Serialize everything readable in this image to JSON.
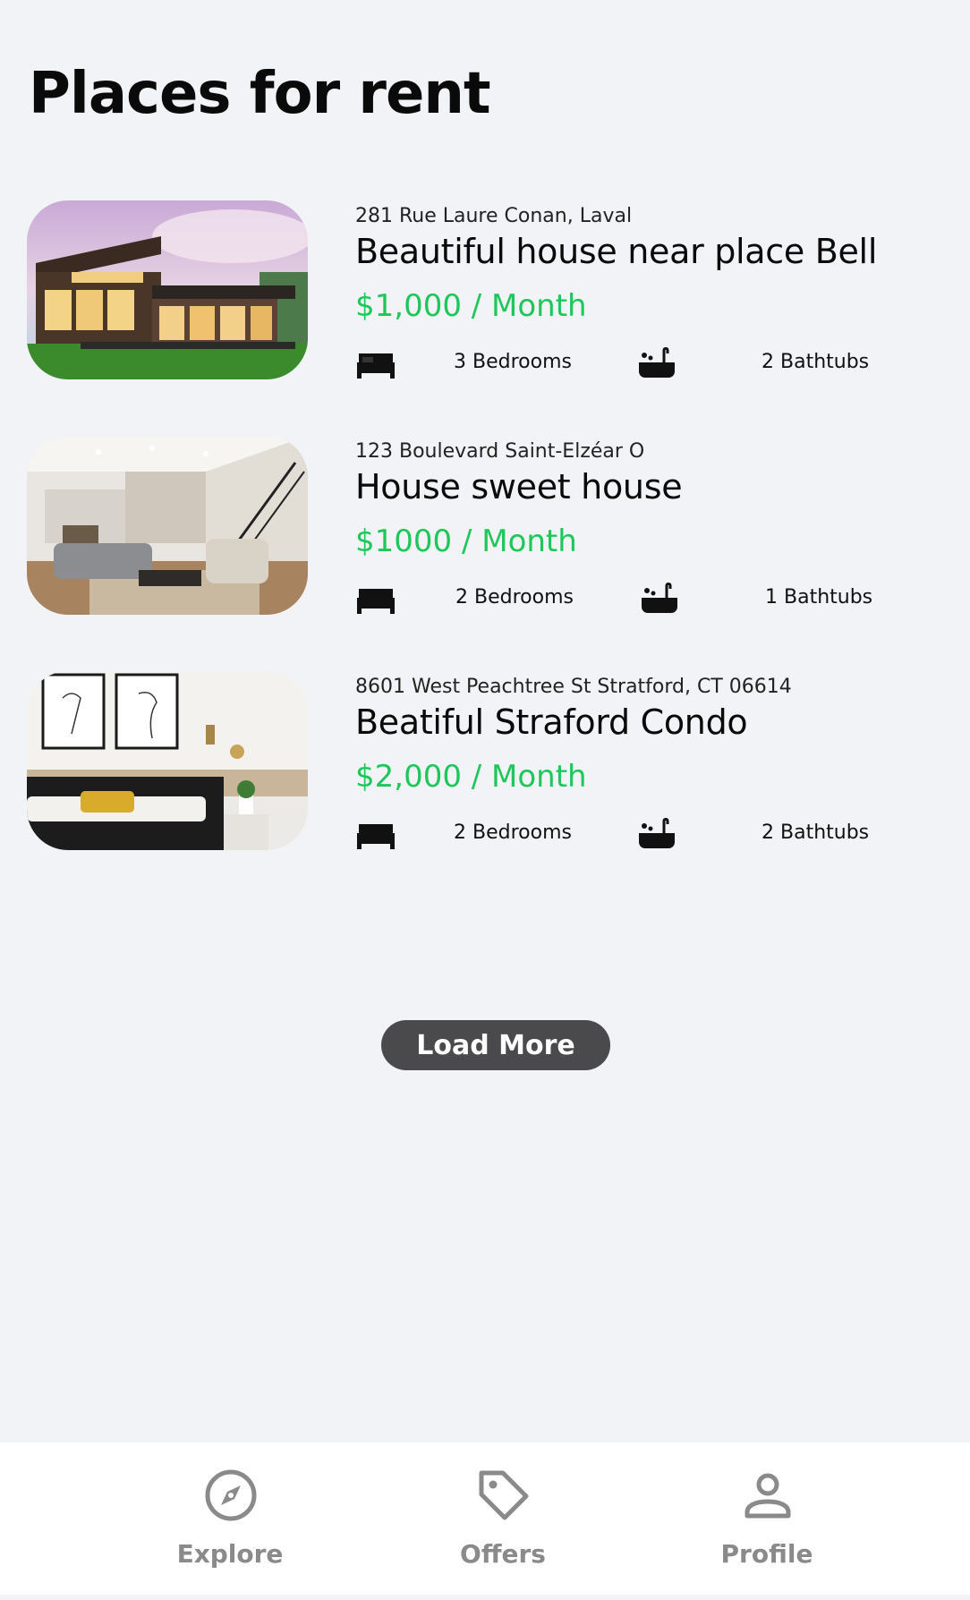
{
  "page": {
    "title": "Places for rent"
  },
  "listings": [
    {
      "address": "281 Rue Laure Conan, Laval",
      "name": "Beautiful house near place Bell",
      "price": "$1,000 / Month",
      "bedrooms": "3 Bedrooms",
      "bathtubs": "2 Bathtubs",
      "image": "modern-house-exterior"
    },
    {
      "address": "123 Boulevard Saint-Elzéar O",
      "name": "House sweet house",
      "price": "$1000 / Month",
      "bedrooms": "2 Bedrooms",
      "bathtubs": "1 Bathtubs",
      "image": "living-room-interior"
    },
    {
      "address": "8601 West Peachtree St Stratford, CT 06614",
      "name": "Beatiful Straford Condo",
      "price": "$2,000 / Month",
      "bedrooms": "2 Bedrooms",
      "bathtubs": "2 Bathtubs",
      "image": "bedroom-interior"
    }
  ],
  "load_more_label": "Load More",
  "nav": {
    "items": [
      {
        "label": "Explore",
        "icon": "compass-icon"
      },
      {
        "label": "Offers",
        "icon": "tag-icon"
      },
      {
        "label": "Profile",
        "icon": "person-icon"
      }
    ]
  },
  "colors": {
    "price": "#1fc75a",
    "button": "#4a4a4c",
    "nav_label": "#8a8a8a",
    "background": "#f2f3f6"
  }
}
